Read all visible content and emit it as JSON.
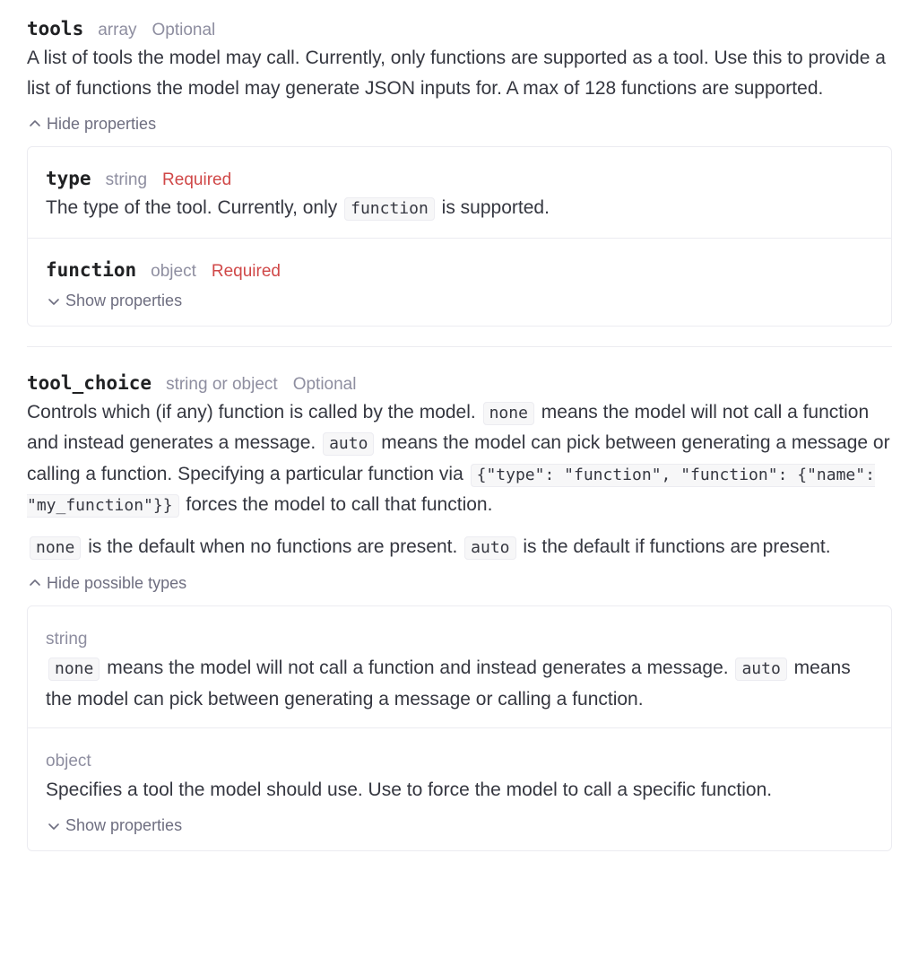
{
  "tools": {
    "name": "tools",
    "type": "array",
    "optional": "Optional",
    "description": "A list of tools the model may call. Currently, only functions are supported as a tool. Use this to provide a list of functions the model may generate JSON inputs for. A max of 128 functions are supported.",
    "toggle_label": "Hide properties",
    "properties": [
      {
        "name": "type",
        "type": "string",
        "required": "Required",
        "desc_before": "The type of the tool. Currently, only",
        "code": "function",
        "desc_after": "is supported."
      },
      {
        "name": "function",
        "type": "object",
        "required": "Required",
        "toggle_label": "Show properties"
      }
    ]
  },
  "tool_choice": {
    "name": "tool_choice",
    "type": "string or object",
    "optional": "Optional",
    "desc1": {
      "t1": "Controls which (if any) function is called by the model.",
      "c1": "none",
      "t2": "means the model will not call a function and instead generates a message.",
      "c2": "auto",
      "t3": "means the model can pick between generating a message or calling a function. Specifying a particular function via",
      "c3": "{\"type\": \"function\", \"function\": {\"name\": \"my_function\"}}",
      "t4": "forces the model to call that function."
    },
    "desc2": {
      "c1": "none",
      "t1": "is the default when no functions are present.",
      "c2": "auto",
      "t2": "is the default if functions are present."
    },
    "toggle_label": "Hide possible types",
    "types": [
      {
        "label": "string",
        "c1": "none",
        "t1": "means the model will not call a function and instead generates a message.",
        "c2": "auto",
        "t2": "means the model can pick between generating a message or calling a function."
      },
      {
        "label": "object",
        "description": "Specifies a tool the model should use. Use to force the model to call a specific function.",
        "toggle_label": "Show properties"
      }
    ]
  },
  "icons": {
    "chevron_up": "chevron-up-icon",
    "chevron_down": "chevron-down-icon"
  }
}
